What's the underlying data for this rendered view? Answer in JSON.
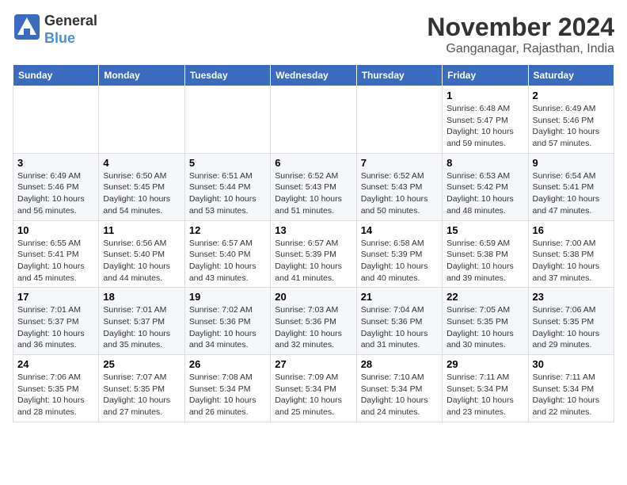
{
  "header": {
    "logo_general": "General",
    "logo_blue": "Blue",
    "month_title": "November 2024",
    "location": "Ganganagar, Rajasthan, India"
  },
  "days_of_week": [
    "Sunday",
    "Monday",
    "Tuesday",
    "Wednesday",
    "Thursday",
    "Friday",
    "Saturday"
  ],
  "weeks": [
    {
      "days": [
        {
          "date": "",
          "info": ""
        },
        {
          "date": "",
          "info": ""
        },
        {
          "date": "",
          "info": ""
        },
        {
          "date": "",
          "info": ""
        },
        {
          "date": "",
          "info": ""
        },
        {
          "date": "1",
          "info": "Sunrise: 6:48 AM\nSunset: 5:47 PM\nDaylight: 10 hours and 59 minutes."
        },
        {
          "date": "2",
          "info": "Sunrise: 6:49 AM\nSunset: 5:46 PM\nDaylight: 10 hours and 57 minutes."
        }
      ]
    },
    {
      "days": [
        {
          "date": "3",
          "info": "Sunrise: 6:49 AM\nSunset: 5:46 PM\nDaylight: 10 hours and 56 minutes."
        },
        {
          "date": "4",
          "info": "Sunrise: 6:50 AM\nSunset: 5:45 PM\nDaylight: 10 hours and 54 minutes."
        },
        {
          "date": "5",
          "info": "Sunrise: 6:51 AM\nSunset: 5:44 PM\nDaylight: 10 hours and 53 minutes."
        },
        {
          "date": "6",
          "info": "Sunrise: 6:52 AM\nSunset: 5:43 PM\nDaylight: 10 hours and 51 minutes."
        },
        {
          "date": "7",
          "info": "Sunrise: 6:52 AM\nSunset: 5:43 PM\nDaylight: 10 hours and 50 minutes."
        },
        {
          "date": "8",
          "info": "Sunrise: 6:53 AM\nSunset: 5:42 PM\nDaylight: 10 hours and 48 minutes."
        },
        {
          "date": "9",
          "info": "Sunrise: 6:54 AM\nSunset: 5:41 PM\nDaylight: 10 hours and 47 minutes."
        }
      ]
    },
    {
      "days": [
        {
          "date": "10",
          "info": "Sunrise: 6:55 AM\nSunset: 5:41 PM\nDaylight: 10 hours and 45 minutes."
        },
        {
          "date": "11",
          "info": "Sunrise: 6:56 AM\nSunset: 5:40 PM\nDaylight: 10 hours and 44 minutes."
        },
        {
          "date": "12",
          "info": "Sunrise: 6:57 AM\nSunset: 5:40 PM\nDaylight: 10 hours and 43 minutes."
        },
        {
          "date": "13",
          "info": "Sunrise: 6:57 AM\nSunset: 5:39 PM\nDaylight: 10 hours and 41 minutes."
        },
        {
          "date": "14",
          "info": "Sunrise: 6:58 AM\nSunset: 5:39 PM\nDaylight: 10 hours and 40 minutes."
        },
        {
          "date": "15",
          "info": "Sunrise: 6:59 AM\nSunset: 5:38 PM\nDaylight: 10 hours and 39 minutes."
        },
        {
          "date": "16",
          "info": "Sunrise: 7:00 AM\nSunset: 5:38 PM\nDaylight: 10 hours and 37 minutes."
        }
      ]
    },
    {
      "days": [
        {
          "date": "17",
          "info": "Sunrise: 7:01 AM\nSunset: 5:37 PM\nDaylight: 10 hours and 36 minutes."
        },
        {
          "date": "18",
          "info": "Sunrise: 7:01 AM\nSunset: 5:37 PM\nDaylight: 10 hours and 35 minutes."
        },
        {
          "date": "19",
          "info": "Sunrise: 7:02 AM\nSunset: 5:36 PM\nDaylight: 10 hours and 34 minutes."
        },
        {
          "date": "20",
          "info": "Sunrise: 7:03 AM\nSunset: 5:36 PM\nDaylight: 10 hours and 32 minutes."
        },
        {
          "date": "21",
          "info": "Sunrise: 7:04 AM\nSunset: 5:36 PM\nDaylight: 10 hours and 31 minutes."
        },
        {
          "date": "22",
          "info": "Sunrise: 7:05 AM\nSunset: 5:35 PM\nDaylight: 10 hours and 30 minutes."
        },
        {
          "date": "23",
          "info": "Sunrise: 7:06 AM\nSunset: 5:35 PM\nDaylight: 10 hours and 29 minutes."
        }
      ]
    },
    {
      "days": [
        {
          "date": "24",
          "info": "Sunrise: 7:06 AM\nSunset: 5:35 PM\nDaylight: 10 hours and 28 minutes."
        },
        {
          "date": "25",
          "info": "Sunrise: 7:07 AM\nSunset: 5:35 PM\nDaylight: 10 hours and 27 minutes."
        },
        {
          "date": "26",
          "info": "Sunrise: 7:08 AM\nSunset: 5:34 PM\nDaylight: 10 hours and 26 minutes."
        },
        {
          "date": "27",
          "info": "Sunrise: 7:09 AM\nSunset: 5:34 PM\nDaylight: 10 hours and 25 minutes."
        },
        {
          "date": "28",
          "info": "Sunrise: 7:10 AM\nSunset: 5:34 PM\nDaylight: 10 hours and 24 minutes."
        },
        {
          "date": "29",
          "info": "Sunrise: 7:11 AM\nSunset: 5:34 PM\nDaylight: 10 hours and 23 minutes."
        },
        {
          "date": "30",
          "info": "Sunrise: 7:11 AM\nSunset: 5:34 PM\nDaylight: 10 hours and 22 minutes."
        }
      ]
    }
  ]
}
